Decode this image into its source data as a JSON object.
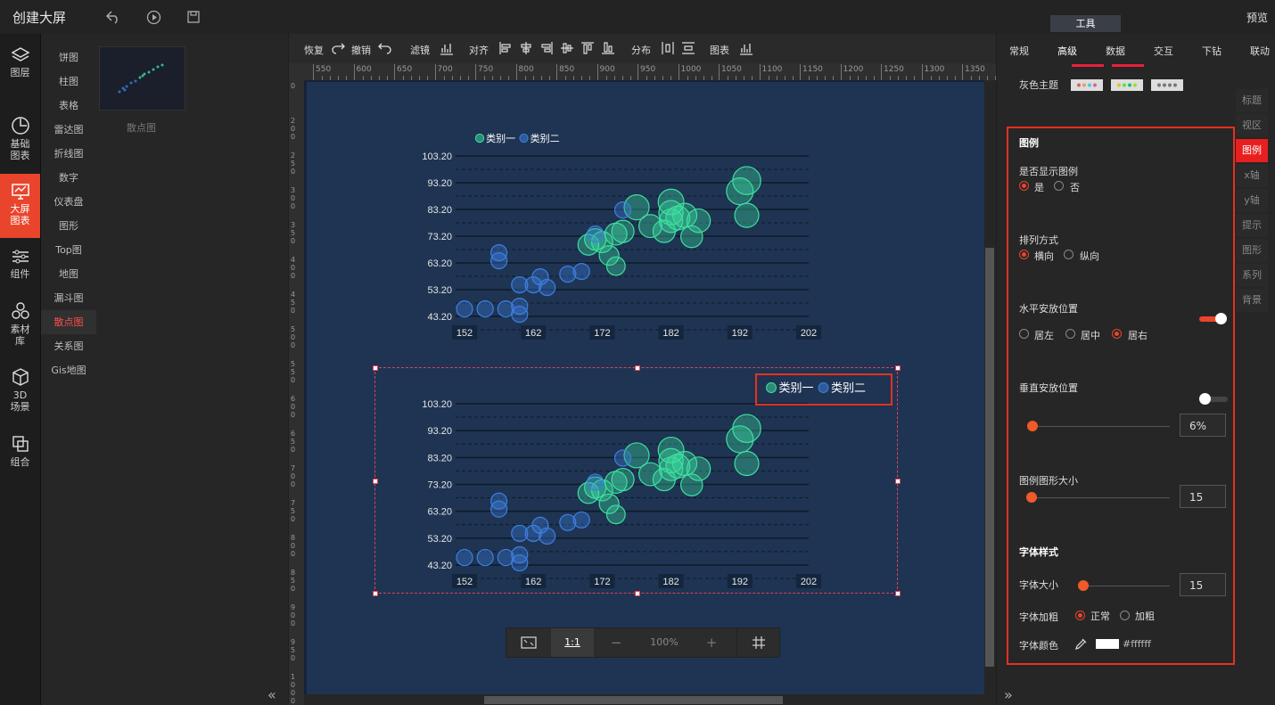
{
  "app": {
    "title": "创建大屏",
    "preview": "预览",
    "tool_tab": "工具"
  },
  "rail": [
    {
      "label": "图层",
      "icon": "layers-icon"
    },
    {
      "label": "基础\n图表",
      "icon": "pie-clock-icon"
    },
    {
      "label": "大屏\n图表",
      "icon": "screen-chart-icon",
      "active": true
    },
    {
      "label": "组件",
      "icon": "sliders-icon"
    },
    {
      "label": "素材\n库",
      "icon": "hexagons-icon"
    },
    {
      "label": "3D\n场景",
      "icon": "cube-icon"
    },
    {
      "label": "组合",
      "icon": "combine-icon"
    }
  ],
  "categories": [
    "饼图",
    "柱图",
    "表格",
    "雷达图",
    "折线图",
    "数字",
    "仪表盘",
    "图形",
    "Top图",
    "地图",
    "漏斗图",
    "散点图",
    "关系图",
    "Gis地图"
  ],
  "active_category": "散点图",
  "thumb_label": "散点图",
  "toolbar": {
    "redo": "恢复",
    "undo": "撤销",
    "filter": "滤镜",
    "align": "对齐",
    "distribute": "分布",
    "chart": "图表"
  },
  "ruler_top": [
    "550",
    "600",
    "650",
    "700",
    "750",
    "800",
    "850",
    "900",
    "950",
    "1000",
    "1050",
    "1100",
    "1150",
    "1200",
    "1250",
    "1300",
    "1350"
  ],
  "ruler_left": [
    "0",
    "200",
    "250",
    "300",
    "350",
    "400",
    "450",
    "500",
    "550",
    "600",
    "650",
    "700",
    "750",
    "800",
    "850",
    "900",
    "950",
    "1000"
  ],
  "zoom": {
    "ratio": "1:1",
    "minus": "−",
    "percent": "100%",
    "plus": "+"
  },
  "right_tabs": [
    "常规",
    "高级",
    "数据",
    "交互",
    "下钻",
    "联动"
  ],
  "theme_label": "灰色主题",
  "side_tabs": [
    "标题",
    "视区",
    "图例",
    "x轴",
    "y轴",
    "提示",
    "图形",
    "系列",
    "背景"
  ],
  "legend_panel": {
    "heading": "图例",
    "show_label": "是否显示图例",
    "yes": "是",
    "no": "否",
    "orient_label": "排列方式",
    "horizontal": "横向",
    "vertical": "纵向",
    "hpos_label": "水平安放位置",
    "left": "居左",
    "center": "居中",
    "right": "居右",
    "vpos_label": "垂直安放位置",
    "vpos_value": "6%",
    "size_label": "图例图形大小",
    "size_value": "15",
    "font_heading": "字体样式",
    "font_size_label": "字体大小",
    "font_size_value": "15",
    "font_weight_label": "字体加粗",
    "normal": "正常",
    "bold": "加粗",
    "font_color_label": "字体颜色",
    "font_color_value": "#ffffff"
  },
  "colors": {
    "accent": "#e8452c",
    "series1": "#3de0a0",
    "series2": "#3d7fe0",
    "canvas": "#1e3452"
  },
  "chart_data": [
    {
      "type": "scatter",
      "legend": [
        "类别一",
        "类别二"
      ],
      "y_ticks": [
        "103.20",
        "93.20",
        "83.20",
        "73.20",
        "63.20",
        "53.20",
        "43.20"
      ],
      "x_ticks": [
        "152",
        "162",
        "172",
        "182",
        "192",
        "202"
      ],
      "xlim": [
        152,
        202
      ],
      "ylim": [
        43.2,
        103.2
      ],
      "series": [
        {
          "name": "类别一",
          "points": [
            [
              174,
              62
            ],
            [
              173,
              66
            ],
            [
              172,
              71
            ],
            [
              171,
              72
            ],
            [
              170,
              70
            ],
            [
              174,
              74
            ],
            [
              175,
              75
            ],
            [
              177,
              84
            ],
            [
              179,
              77
            ],
            [
              181,
              75
            ],
            [
              182,
              86
            ],
            [
              182,
              82
            ],
            [
              182,
              79
            ],
            [
              183,
              80
            ],
            [
              184,
              81
            ],
            [
              185,
              73
            ],
            [
              186,
              79
            ],
            [
              192,
              90
            ],
            [
              193,
              94
            ],
            [
              193,
              81
            ]
          ]
        },
        {
          "name": "类别二",
          "points": [
            [
              152,
              46
            ],
            [
              155,
              46
            ],
            [
              158,
              46
            ],
            [
              160,
              44
            ],
            [
              160,
              47
            ],
            [
              160,
              55
            ],
            [
              162,
              55
            ],
            [
              163,
              58
            ],
            [
              164,
              54
            ],
            [
              157,
              64
            ],
            [
              157,
              67
            ],
            [
              167,
              59
            ],
            [
              169,
              60
            ],
            [
              171,
              74
            ],
            [
              175,
              83
            ]
          ]
        }
      ]
    },
    {
      "type": "scatter",
      "legend": [
        "类别一",
        "类别二"
      ],
      "y_ticks": [
        "103.20",
        "93.20",
        "83.20",
        "73.20",
        "63.20",
        "53.20",
        "43.20"
      ],
      "x_ticks": [
        "152",
        "162",
        "172",
        "182",
        "192",
        "202"
      ],
      "xlim": [
        152,
        202
      ],
      "ylim": [
        43.2,
        103.2
      ],
      "series": [
        {
          "name": "类别一",
          "points": [
            [
              174,
              62
            ],
            [
              173,
              66
            ],
            [
              172,
              71
            ],
            [
              171,
              72
            ],
            [
              170,
              70
            ],
            [
              174,
              74
            ],
            [
              175,
              75
            ],
            [
              177,
              84
            ],
            [
              179,
              77
            ],
            [
              181,
              75
            ],
            [
              182,
              86
            ],
            [
              182,
              82
            ],
            [
              182,
              79
            ],
            [
              183,
              80
            ],
            [
              184,
              81
            ],
            [
              185,
              73
            ],
            [
              186,
              79
            ],
            [
              192,
              90
            ],
            [
              193,
              94
            ],
            [
              193,
              81
            ]
          ]
        },
        {
          "name": "类别二",
          "points": [
            [
              152,
              46
            ],
            [
              155,
              46
            ],
            [
              158,
              46
            ],
            [
              160,
              44
            ],
            [
              160,
              47
            ],
            [
              160,
              55
            ],
            [
              162,
              55
            ],
            [
              163,
              58
            ],
            [
              164,
              54
            ],
            [
              157,
              64
            ],
            [
              157,
              67
            ],
            [
              167,
              59
            ],
            [
              169,
              60
            ],
            [
              171,
              74
            ],
            [
              175,
              83
            ]
          ]
        }
      ]
    }
  ]
}
